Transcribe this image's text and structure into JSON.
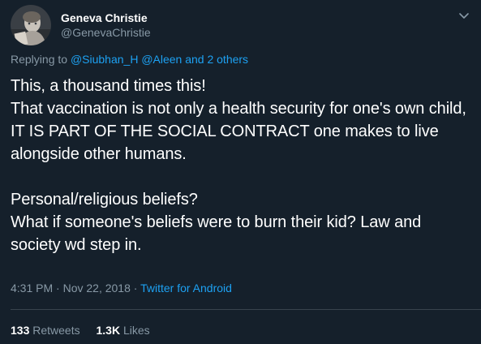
{
  "author": {
    "display_name": "Geneva Christie",
    "handle": "@GenevaChristie"
  },
  "reply": {
    "prefix": "Replying to",
    "mentions": "@Siubhan_H @Aleen and 2 others"
  },
  "tweet": {
    "text": "This, a thousand times this!\nThat vaccination is not only a health security for one's own child, IT IS PART OF THE SOCIAL CONTRACT one makes to live alongside other humans.\n\nPersonal/religious beliefs?\nWhat if someone's beliefs were to burn their kid? Law and society wd step in.",
    "time": "4:31 PM",
    "dot": "·",
    "date": "Nov 22, 2018",
    "source": "Twitter for Android"
  },
  "stats": {
    "retweets_count": "133",
    "retweets_label": "Retweets",
    "likes_count": "1.3K",
    "likes_label": "Likes"
  },
  "icons": {
    "caret": "chevron-down-icon",
    "avatar": "avatar-photo"
  },
  "colors": {
    "background": "#15202b",
    "link": "#1da1f2",
    "secondary_text": "#8899a6",
    "primary_text": "#ffffff"
  }
}
